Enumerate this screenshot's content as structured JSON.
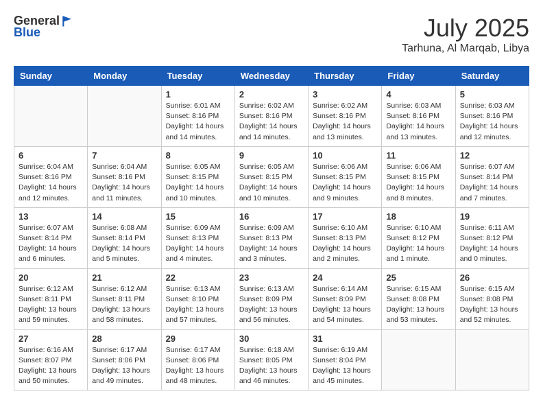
{
  "header": {
    "logo_general": "General",
    "logo_blue": "Blue",
    "month_title": "July 2025",
    "location": "Tarhuna, Al Marqab, Libya"
  },
  "weekdays": [
    "Sunday",
    "Monday",
    "Tuesday",
    "Wednesday",
    "Thursday",
    "Friday",
    "Saturday"
  ],
  "weeks": [
    [
      {
        "day": "",
        "info": ""
      },
      {
        "day": "",
        "info": ""
      },
      {
        "day": "1",
        "info": "Sunrise: 6:01 AM\nSunset: 8:16 PM\nDaylight: 14 hours and 14 minutes."
      },
      {
        "day": "2",
        "info": "Sunrise: 6:02 AM\nSunset: 8:16 PM\nDaylight: 14 hours and 14 minutes."
      },
      {
        "day": "3",
        "info": "Sunrise: 6:02 AM\nSunset: 8:16 PM\nDaylight: 14 hours and 13 minutes."
      },
      {
        "day": "4",
        "info": "Sunrise: 6:03 AM\nSunset: 8:16 PM\nDaylight: 14 hours and 13 minutes."
      },
      {
        "day": "5",
        "info": "Sunrise: 6:03 AM\nSunset: 8:16 PM\nDaylight: 14 hours and 12 minutes."
      }
    ],
    [
      {
        "day": "6",
        "info": "Sunrise: 6:04 AM\nSunset: 8:16 PM\nDaylight: 14 hours and 12 minutes."
      },
      {
        "day": "7",
        "info": "Sunrise: 6:04 AM\nSunset: 8:16 PM\nDaylight: 14 hours and 11 minutes."
      },
      {
        "day": "8",
        "info": "Sunrise: 6:05 AM\nSunset: 8:15 PM\nDaylight: 14 hours and 10 minutes."
      },
      {
        "day": "9",
        "info": "Sunrise: 6:05 AM\nSunset: 8:15 PM\nDaylight: 14 hours and 10 minutes."
      },
      {
        "day": "10",
        "info": "Sunrise: 6:06 AM\nSunset: 8:15 PM\nDaylight: 14 hours and 9 minutes."
      },
      {
        "day": "11",
        "info": "Sunrise: 6:06 AM\nSunset: 8:15 PM\nDaylight: 14 hours and 8 minutes."
      },
      {
        "day": "12",
        "info": "Sunrise: 6:07 AM\nSunset: 8:14 PM\nDaylight: 14 hours and 7 minutes."
      }
    ],
    [
      {
        "day": "13",
        "info": "Sunrise: 6:07 AM\nSunset: 8:14 PM\nDaylight: 14 hours and 6 minutes."
      },
      {
        "day": "14",
        "info": "Sunrise: 6:08 AM\nSunset: 8:14 PM\nDaylight: 14 hours and 5 minutes."
      },
      {
        "day": "15",
        "info": "Sunrise: 6:09 AM\nSunset: 8:13 PM\nDaylight: 14 hours and 4 minutes."
      },
      {
        "day": "16",
        "info": "Sunrise: 6:09 AM\nSunset: 8:13 PM\nDaylight: 14 hours and 3 minutes."
      },
      {
        "day": "17",
        "info": "Sunrise: 6:10 AM\nSunset: 8:13 PM\nDaylight: 14 hours and 2 minutes."
      },
      {
        "day": "18",
        "info": "Sunrise: 6:10 AM\nSunset: 8:12 PM\nDaylight: 14 hours and 1 minute."
      },
      {
        "day": "19",
        "info": "Sunrise: 6:11 AM\nSunset: 8:12 PM\nDaylight: 14 hours and 0 minutes."
      }
    ],
    [
      {
        "day": "20",
        "info": "Sunrise: 6:12 AM\nSunset: 8:11 PM\nDaylight: 13 hours and 59 minutes."
      },
      {
        "day": "21",
        "info": "Sunrise: 6:12 AM\nSunset: 8:11 PM\nDaylight: 13 hours and 58 minutes."
      },
      {
        "day": "22",
        "info": "Sunrise: 6:13 AM\nSunset: 8:10 PM\nDaylight: 13 hours and 57 minutes."
      },
      {
        "day": "23",
        "info": "Sunrise: 6:13 AM\nSunset: 8:09 PM\nDaylight: 13 hours and 56 minutes."
      },
      {
        "day": "24",
        "info": "Sunrise: 6:14 AM\nSunset: 8:09 PM\nDaylight: 13 hours and 54 minutes."
      },
      {
        "day": "25",
        "info": "Sunrise: 6:15 AM\nSunset: 8:08 PM\nDaylight: 13 hours and 53 minutes."
      },
      {
        "day": "26",
        "info": "Sunrise: 6:15 AM\nSunset: 8:08 PM\nDaylight: 13 hours and 52 minutes."
      }
    ],
    [
      {
        "day": "27",
        "info": "Sunrise: 6:16 AM\nSunset: 8:07 PM\nDaylight: 13 hours and 50 minutes."
      },
      {
        "day": "28",
        "info": "Sunrise: 6:17 AM\nSunset: 8:06 PM\nDaylight: 13 hours and 49 minutes."
      },
      {
        "day": "29",
        "info": "Sunrise: 6:17 AM\nSunset: 8:06 PM\nDaylight: 13 hours and 48 minutes."
      },
      {
        "day": "30",
        "info": "Sunrise: 6:18 AM\nSunset: 8:05 PM\nDaylight: 13 hours and 46 minutes."
      },
      {
        "day": "31",
        "info": "Sunrise: 6:19 AM\nSunset: 8:04 PM\nDaylight: 13 hours and 45 minutes."
      },
      {
        "day": "",
        "info": ""
      },
      {
        "day": "",
        "info": ""
      }
    ]
  ]
}
